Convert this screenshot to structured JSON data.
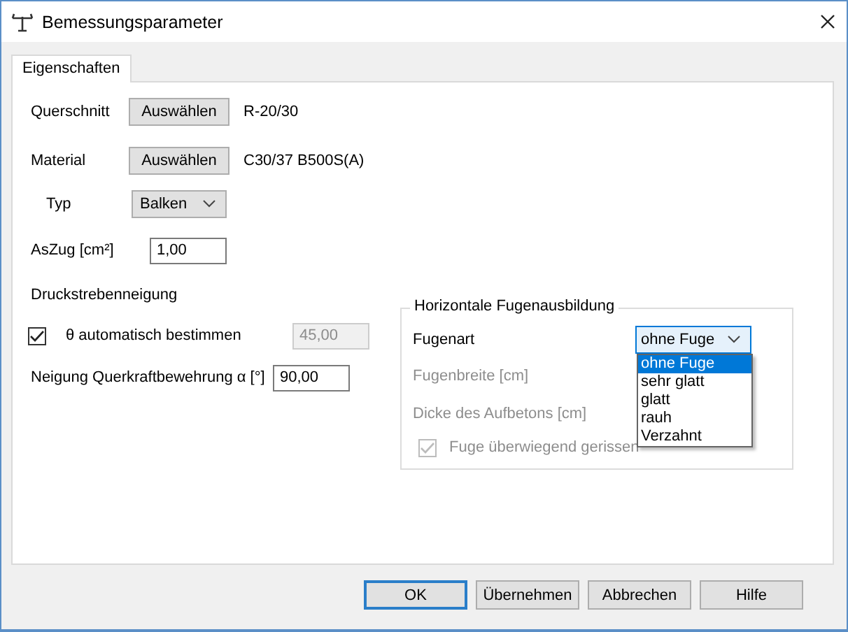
{
  "window": {
    "title": "Bemessungsparameter"
  },
  "tabs": [
    {
      "label": "Eigenschaften",
      "selected": true
    }
  ],
  "querschnitt": {
    "label": "Querschnitt",
    "button": "Auswählen",
    "value": "R-20/30"
  },
  "material": {
    "label": "Material",
    "button": "Auswählen",
    "value": "C30/37 B500S(A)"
  },
  "typ": {
    "label": "Typ",
    "value": "Balken"
  },
  "aszug": {
    "label": "AsZug [cm²]",
    "value": "1,00"
  },
  "druckstrebenneigung": {
    "title": "Druckstrebenneigung",
    "theta": {
      "label": "θ automatisch bestimmen",
      "checked": true,
      "value": "45,00",
      "value_disabled": true
    },
    "neigung": {
      "label": "Neigung Querkraftbewehrung α [°]",
      "value": "90,00"
    }
  },
  "fugen": {
    "title": "Horizontale Fugenausbildung",
    "fugenart": {
      "label": "Fugenart",
      "value": "ohne Fuge",
      "expanded": true,
      "options": [
        {
          "label": "ohne Fuge",
          "selected": true
        },
        {
          "label": "sehr glatt",
          "selected": false
        },
        {
          "label": "glatt",
          "selected": false
        },
        {
          "label": "rauh",
          "selected": false
        },
        {
          "label": "Verzahnt",
          "selected": false
        }
      ]
    },
    "fugenbreite": {
      "label": "Fugenbreite [cm]",
      "disabled": true
    },
    "dicke": {
      "label": "Dicke des Aufbetons [cm]",
      "disabled": true
    },
    "gerissen": {
      "label": "Fuge überwiegend gerissen",
      "checked": true,
      "disabled": true
    }
  },
  "buttons": [
    {
      "label": "OK",
      "default": true
    },
    {
      "label": "Übernehmen",
      "default": false
    },
    {
      "label": "Abbrechen",
      "default": false
    },
    {
      "label": "Hilfe",
      "default": false
    }
  ]
}
